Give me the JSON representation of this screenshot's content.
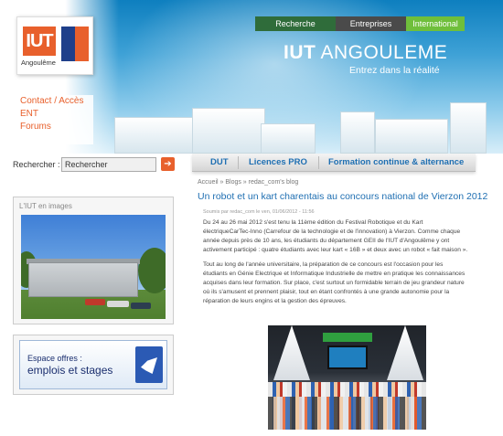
{
  "header": {
    "logo": {
      "iut": "IUT",
      "city": "Angoulême",
      "univ_text": "UNIVERSITÉ DE POITIERS"
    },
    "top_nav": [
      "Recherche",
      "Entreprises",
      "International"
    ],
    "brand_bold": "IUT",
    "brand_rest": " ANGOULEME",
    "tagline": "Entrez dans la réalité",
    "colors": {
      "accent": "#e8602c",
      "link": "#1f6fb2",
      "recherche": "#2f6c3a",
      "entreprises": "#4a4a4a",
      "international": "#6fbf3b"
    }
  },
  "left_links": [
    "Contact / Accès",
    "ENT",
    "Forums"
  ],
  "search": {
    "label": "Rechercher :",
    "value": "Rechercher",
    "button_icon": "arrow-right-icon"
  },
  "images_box": {
    "title": "L'IUT en images"
  },
  "offers_box": {
    "line1": "Espace offres :",
    "line2": "emplois et stages"
  },
  "main_tabs": [
    "DUT",
    "Licences PRO",
    "Formation continue & alternance"
  ],
  "breadcrumb": "Accueil » Blogs » redac_com's blog",
  "article": {
    "title": "Un robot et un kart charentais au concours national de Vierzon 2012",
    "meta": "Soumis par redac_com le ven, 01/06/2012 - 11:56",
    "p1": "Du 24 au 26 mai 2012 s'est tenu la 11ème édition du Festival Robotique et du Kart électriqueCarTec-Inno (Carrefour de la technologie et de l'innovation) à Vierzon. Comme chaque année depuis près de 10 ans, les étudiants du département GEII de l'IUT d'Angoulême y ont activement participé : quatre étudiants avec leur kart « 16B » et deux avec un robot « fait maison ».",
    "p2": "Tout au long de l'année universitaire, la préparation de ce concours est l'occasion pour les étudiants en Génie Electrique et Informatique Industrielle de mettre en pratique les connaissances acquises dans leur formation. Sur place, c'est surtout un formidable terrain de jeu grandeur nature où ils s'amusent et prennent plaisir, tout en étant confrontés à une grande autonomie pour la réparation de leurs engins et la gestion des épreuves."
  }
}
